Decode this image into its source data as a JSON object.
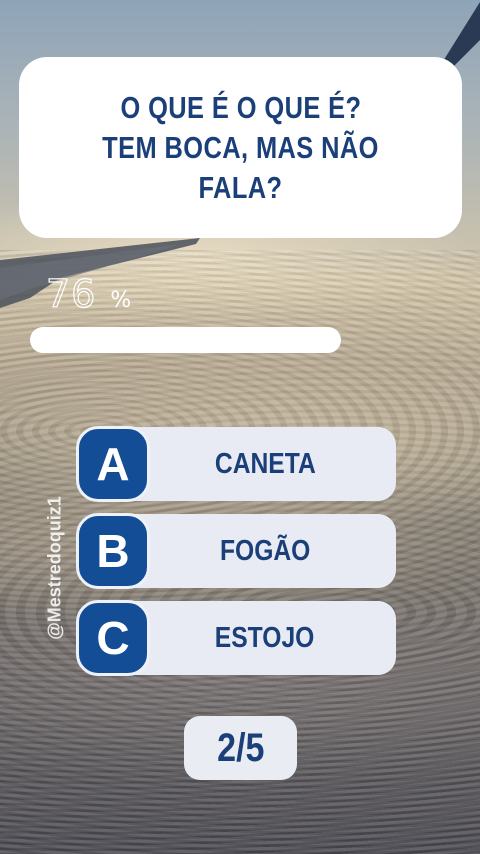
{
  "question": {
    "lines": [
      "O QUE É O QUE É?",
      "TEM BOCA, MAS NÃO FALA?"
    ]
  },
  "timer": {
    "value": "76",
    "unit": "%",
    "progress": 0.76
  },
  "watermark": "@Mestredoquiz1",
  "answers": [
    {
      "letter": "A",
      "label": "CANETA"
    },
    {
      "letter": "B",
      "label": "FOGÃO"
    },
    {
      "letter": "C",
      "label": "ESTOJO"
    }
  ],
  "pagination": {
    "label": "2/5"
  },
  "colors": {
    "primary": "#134d96",
    "text_dark": "#1b3f78",
    "card": "#ffffff",
    "pill": "#e8ebf3"
  },
  "icons": {
    "background": "airplane-wing-over-clouds"
  }
}
